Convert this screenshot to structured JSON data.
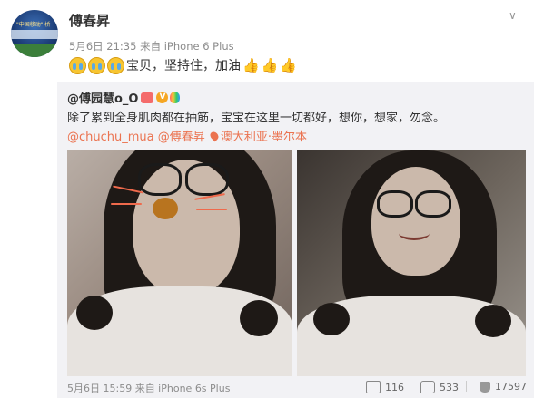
{
  "post": {
    "author": "傅春昇",
    "menu_arrow": "∨",
    "meta": "5月6日 21:35 来自 iPhone 6 Plus",
    "text": "宝贝，坚持住，加油"
  },
  "avatar": {
    "text": "\"中国移动\" 桥"
  },
  "repost": {
    "author": "@傅园慧o_O",
    "text_before": "除了累到全身肌肉都在抽筋，宝宝在这里一切都好，想你，想家，勿念。",
    "mention1": "@chuchu_mua",
    "mention2": "@傅春昇",
    "location": "澳大利亚·墨尔本",
    "footer_meta": "5月6日 15:59 来自 iPhone 6s Plus",
    "repost_count": "116",
    "comment_count": "533",
    "like_count": "17597"
  },
  "icons": {
    "cry": "crying-face-emoji",
    "thumb": "thumbs-up-emoji",
    "repost": "repost-icon",
    "comment": "comment-icon",
    "like": "like-icon"
  }
}
